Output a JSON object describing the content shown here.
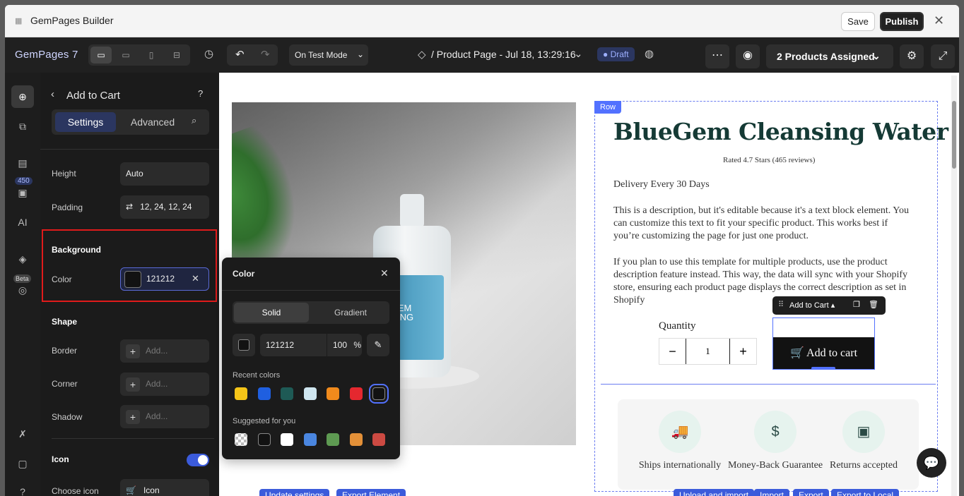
{
  "titlebar": {
    "title": "GemPages Builder",
    "save": "Save",
    "publish": "Publish"
  },
  "topbar": {
    "logo": "GemPages 7",
    "test_mode": "On Test Mode",
    "page_name": "/ Product Page - Jul 18, 13:29:16",
    "draft": "Draft",
    "assigned": "2 Products Assigned"
  },
  "rail": {
    "badge": "450",
    "ai": "AI",
    "beta": "Beta"
  },
  "panel": {
    "title": "Add to Cart",
    "tabs": [
      "Settings",
      "Advanced"
    ],
    "height_label": "Height",
    "height_value": "Auto",
    "padding_label": "Padding",
    "padding_value": "12, 24, 12, 24",
    "background_section": "Background",
    "color_label": "Color",
    "color_value": "121212",
    "shape_section": "Shape",
    "border_label": "Border",
    "corner_label": "Corner",
    "shadow_label": "Shadow",
    "add_placeholder": "Add...",
    "icon_section": "Icon",
    "choose_icon_label": "Choose icon",
    "choose_icon_value": "Icon"
  },
  "popover": {
    "title": "Color",
    "tabs": [
      "Solid",
      "Gradient"
    ],
    "hex": "121212",
    "opacity": "100",
    "opacity_unit": "%",
    "recent_label": "Recent colors",
    "suggested_label": "Suggested for you",
    "recent_colors": [
      "#f5c518",
      "#1f5fe0",
      "#1e5a55",
      "#cfe6f0",
      "#f08a1c",
      "#e5282f",
      "#121212"
    ],
    "suggested_colors": [
      "transparent",
      "#121212",
      "#ffffff",
      "#4a86e0",
      "#5e9a52",
      "#e39038",
      "#cc4a42"
    ]
  },
  "canvas": {
    "row_tag": "Row",
    "product_title": "BlueGem Cleansing Water",
    "rated": "Rated 4.7 Stars (465 reviews)",
    "delivery": "Delivery Every 30 Days",
    "desc1": "This is a description, but it's editable because it's a text block element. You can customize this text to fit your specific product. This works best if you’re customizing the page for just one product.",
    "desc2": "If you plan to use this template for multiple products, use the product description feature instead. This way, the data will sync with your Shopify store, ensuring each product page displays the correct description as set in Shopify",
    "quantity_label": "Quantity",
    "quantity_value": "1",
    "atc_toolbar": "Add to Cart",
    "atc_button": "Add to cart",
    "features": [
      "Ships internationally",
      "Money-Back Guarantee",
      "Returns accepted"
    ],
    "label_text": "EGEM\nNSING\nER",
    "chips_left": [
      "Update settings",
      "Export Element"
    ],
    "chips_right": [
      "Upload and import",
      "Import",
      "Export",
      "Export to Local"
    ]
  }
}
